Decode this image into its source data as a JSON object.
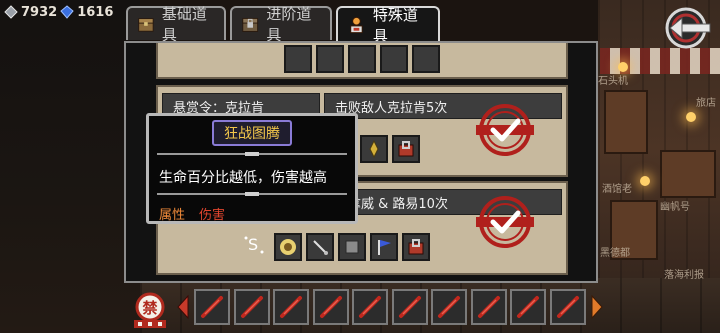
{
  "currency": {
    "coins": "7932",
    "gems": "1616"
  },
  "tabs": [
    {
      "label": "基础道具",
      "icon": "chest-icon",
      "active": false
    },
    {
      "label": "进阶道具",
      "icon": "locked-chest-icon",
      "active": false
    },
    {
      "label": "特殊道具",
      "icon": "special-items-icon",
      "active": true
    }
  ],
  "entries": [
    {
      "name": "悬赏令：克拉肯",
      "condition": "击败敌人克拉肯5次",
      "completed": true
    },
    {
      "name": "",
      "condition": "人拿威 & 路易10次",
      "completed": true
    }
  ],
  "tooltip": {
    "title": "狂战图腾",
    "description": "生命百分比越低，伤害越高",
    "tag_label": "属性",
    "tag_value": "伤害"
  },
  "background_signs": [
    "石头机",
    "旅店",
    "酒馆老",
    "幽帆号",
    "黑德都",
    "落海利报"
  ],
  "bottom": {
    "banned_label": "禁",
    "weapon_slots": 10
  },
  "colors": {
    "panel_bg": "#121212",
    "entry_bg": "#c7b99e",
    "stamp_red": "#b0201c",
    "tooltip_title": "#f2c64a",
    "tag_orange": "#f08a3a",
    "tag_red": "#e0452e"
  }
}
